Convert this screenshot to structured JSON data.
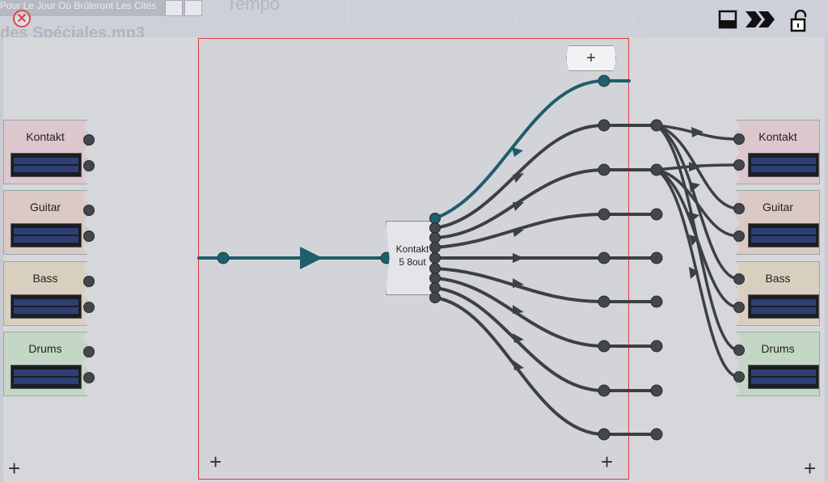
{
  "header": {
    "song_title": "Pour Le Jour Où Brûleront Les Cités",
    "file_title": "des Spéciales.mp3",
    "tempo_label": "Tempo"
  },
  "toolbar": {
    "close_icon": "close-icon",
    "icons": [
      "panel-icon",
      "forward-icon",
      "unlock-icon"
    ]
  },
  "inputs": [
    {
      "name": "Kontakt",
      "color": "#dcc7cc"
    },
    {
      "name": "Guitar",
      "color": "#dbc9c4"
    },
    {
      "name": "Bass",
      "color": "#d9cfbf"
    },
    {
      "name": "Drums",
      "color": "#c4d6c5"
    }
  ],
  "outputs": [
    {
      "name": "Kontakt",
      "color": "#dcc7cc"
    },
    {
      "name": "Guitar",
      "color": "#dbc9c4"
    },
    {
      "name": "Bass",
      "color": "#d9cfbf"
    },
    {
      "name": "Drums",
      "color": "#c4d6c5"
    }
  ],
  "plugin": {
    "line1": "Kontakt",
    "line2": "5 8out"
  },
  "add_label": "+",
  "colors": {
    "teal_wire": "#1f5e6b",
    "gray_wire": "#3d3f47",
    "border_red": "#d23a3f"
  }
}
